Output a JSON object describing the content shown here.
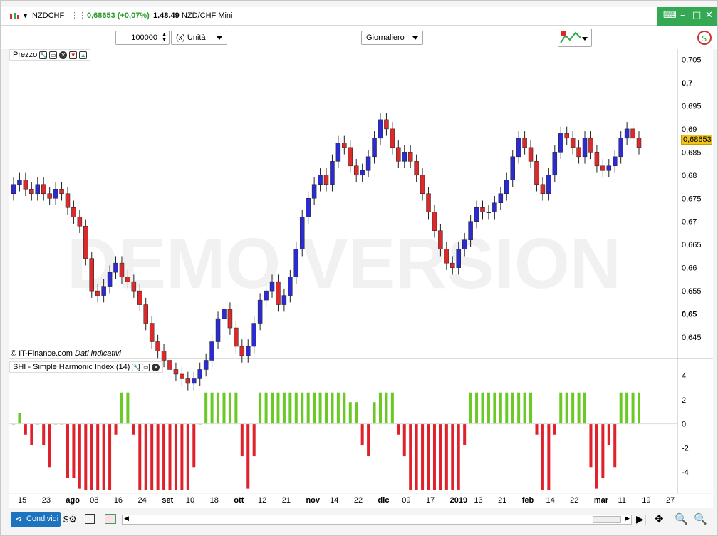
{
  "title_bar": {
    "symbol": "NZDCHF",
    "price_change": "0,68653 (+0,07%)",
    "time": "1.48.49",
    "instrument_name": "NZD/CHF Mini"
  },
  "toolbar": {
    "quantity": "100000",
    "unit_select": "(x) Unità",
    "period_select": "Giornaliero"
  },
  "price_panel": {
    "label": "Prezzo",
    "last_price": "0,68653",
    "yticks": [
      "0,705",
      "0,7",
      "0,695",
      "0,69",
      "0,685",
      "0,68",
      "0,675",
      "0,67",
      "0,665",
      "0,66",
      "0,655",
      "0,65",
      "0,645"
    ],
    "watermark": "DEMO VERSION",
    "credit": "© IT-Finance.com",
    "credit_note": "Dati indicativi"
  },
  "indicator_panel": {
    "label": "SHI - Simple Harmonic Index (14)",
    "yticks": [
      "4",
      "2",
      "0",
      "-2",
      "-4"
    ]
  },
  "xaxis": {
    "labels": [
      "15",
      "23",
      "ago",
      "08",
      "16",
      "24",
      "set",
      "10",
      "18",
      "ott",
      "12",
      "21",
      "nov",
      "14",
      "22",
      "dic",
      "09",
      "17",
      "2019",
      "13",
      "21",
      "feb",
      "14",
      "22",
      "mar",
      "11",
      "19",
      "27"
    ]
  },
  "bottom_bar": {
    "share_label": "Condividi"
  },
  "colors": {
    "up": "#2b2bd0",
    "down": "#d92b2b",
    "hist_pos": "#6ac925",
    "hist_neg": "#e0202a",
    "accent": "#1e73be"
  },
  "chart_data": {
    "type": "candlestick",
    "price_ylim": [
      0.641,
      0.706
    ],
    "indicator_ylim": [
      -5.6,
      4.6
    ],
    "closes": [
      0.678,
      0.679,
      0.677,
      0.676,
      0.678,
      0.676,
      0.675,
      0.677,
      0.676,
      0.673,
      0.671,
      0.669,
      0.662,
      0.655,
      0.654,
      0.656,
      0.659,
      0.661,
      0.658,
      0.657,
      0.655,
      0.652,
      0.648,
      0.644,
      0.642,
      0.64,
      0.638,
      0.637,
      0.636,
      0.635,
      0.636,
      0.638,
      0.64,
      0.644,
      0.649,
      0.651,
      0.647,
      0.643,
      0.641,
      0.643,
      0.648,
      0.653,
      0.655,
      0.657,
      0.652,
      0.654,
      0.658,
      0.664,
      0.671,
      0.675,
      0.678,
      0.68,
      0.678,
      0.683,
      0.687,
      0.686,
      0.682,
      0.68,
      0.681,
      0.684,
      0.688,
      0.692,
      0.69,
      0.686,
      0.683,
      0.685,
      0.683,
      0.68,
      0.676,
      0.672,
      0.668,
      0.664,
      0.661,
      0.66,
      0.664,
      0.666,
      0.67,
      0.673,
      0.672,
      0.672,
      0.674,
      0.676,
      0.679,
      0.684,
      0.688,
      0.686,
      0.683,
      0.678,
      0.676,
      0.68,
      0.685,
      0.689,
      0.688,
      0.686,
      0.684,
      0.688,
      0.685,
      0.682,
      0.681,
      0.682,
      0.684,
      0.688,
      0.69,
      0.688,
      0.686
    ]
  }
}
